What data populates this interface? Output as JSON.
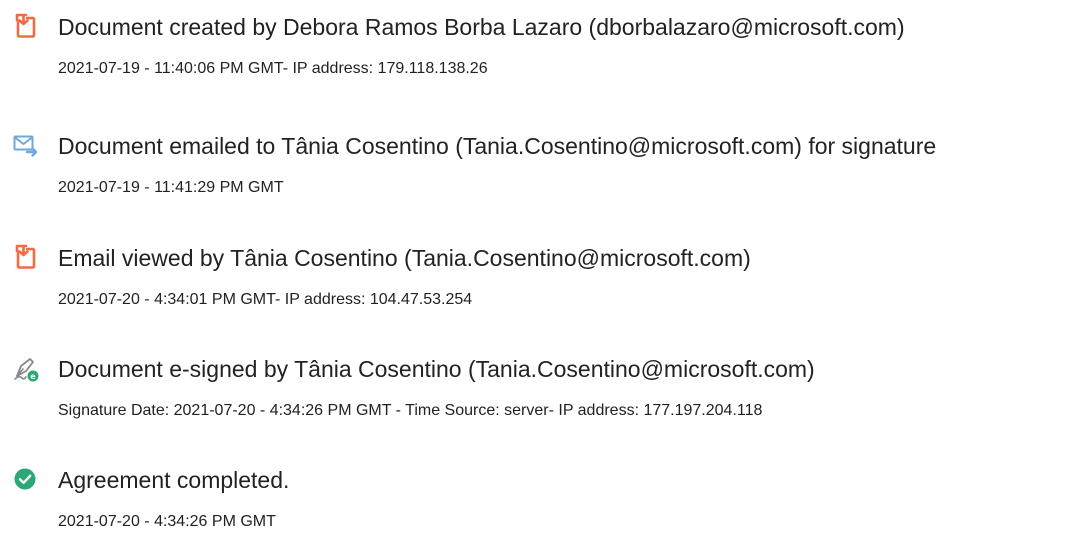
{
  "colors": {
    "document_icon": "#f26b43",
    "email_icon": "#6ea8dc",
    "signed_icon_pen": "#888888",
    "signed_icon_badge": "#2ba875",
    "completed_icon": "#2ba875",
    "text": "#222222"
  },
  "events": [
    {
      "icon": "document-created-icon",
      "title": "Document created by Debora Ramos Borba Lazaro (dborbalazaro@microsoft.com)",
      "detail": "2021-07-19 - 11:40:06 PM GMT- IP address: 179.118.138.26"
    },
    {
      "icon": "email-sent-icon",
      "title": "Document emailed to Tânia Cosentino (Tania.Cosentino@microsoft.com) for signature",
      "detail": "2021-07-19 - 11:41:29 PM GMT"
    },
    {
      "icon": "email-viewed-icon",
      "title": "Email viewed by Tânia Cosentino (Tania.Cosentino@microsoft.com)",
      "detail": "2021-07-20 - 4:34:01 PM GMT- IP address: 104.47.53.254"
    },
    {
      "icon": "e-signature-icon",
      "title": "Document e-signed by Tânia Cosentino (Tania.Cosentino@microsoft.com)",
      "detail": "Signature Date: 2021-07-20 - 4:34:26 PM GMT - Time Source: server- IP address: 177.197.204.118"
    },
    {
      "icon": "checkmark-circle-icon",
      "title": "Agreement completed.",
      "detail": "2021-07-20 - 4:34:26 PM GMT"
    }
  ]
}
